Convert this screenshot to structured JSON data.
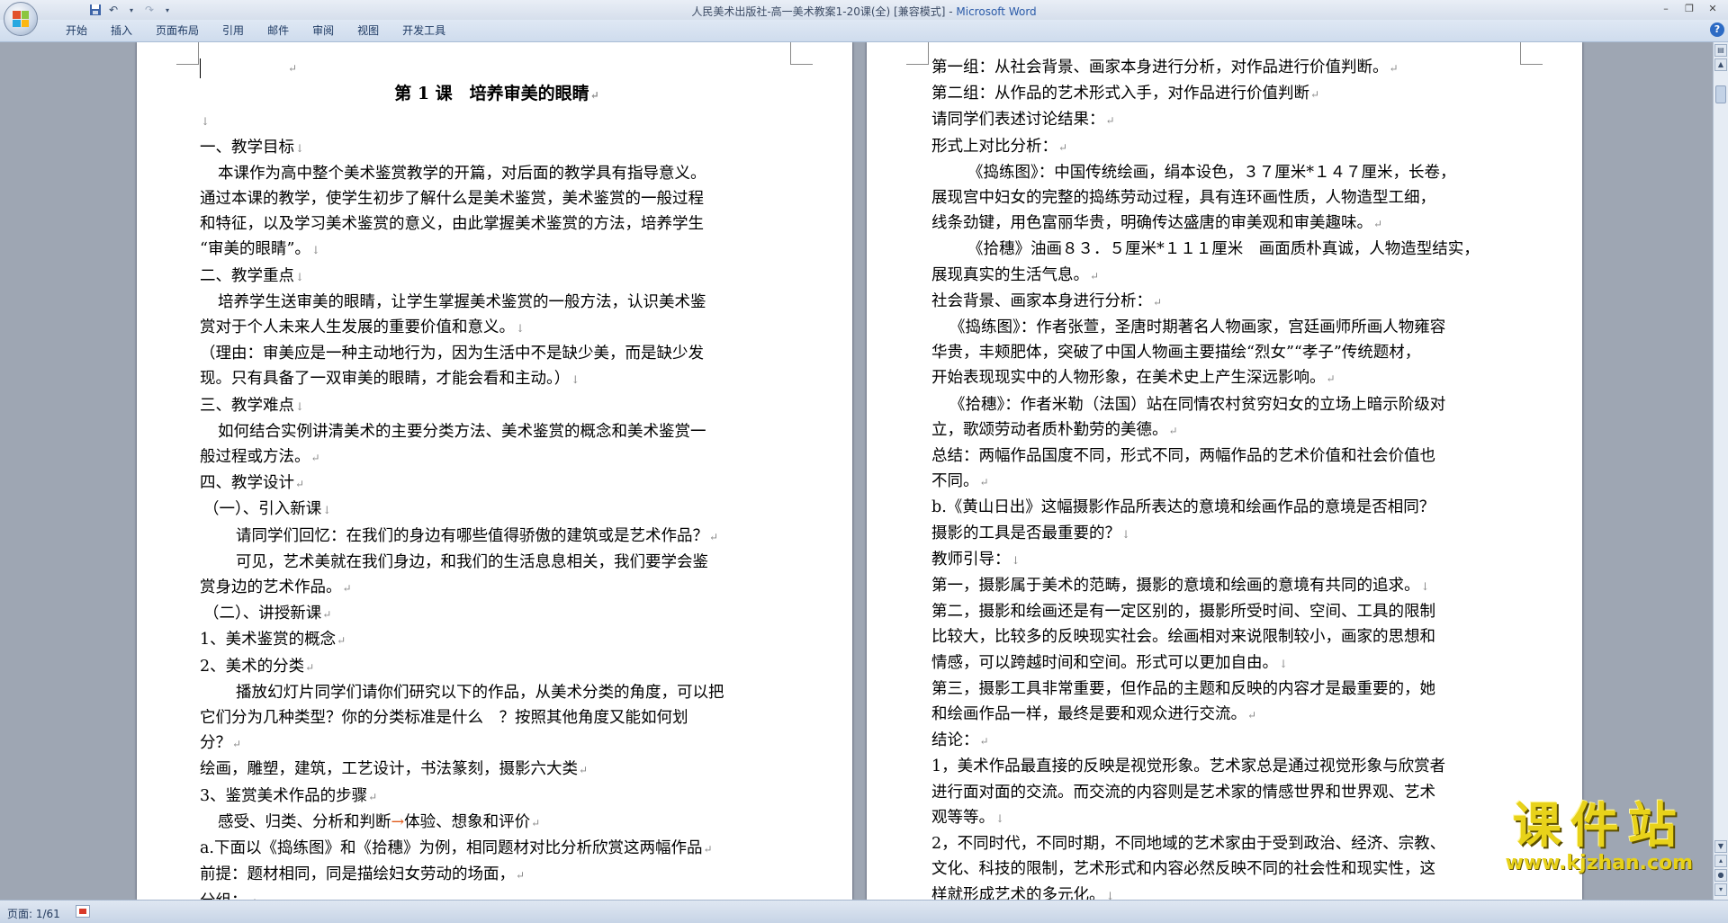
{
  "window": {
    "title": "人民美术出版社-高一美术教案1-20课(全) [兼容模式] - ",
    "app": "Microsoft Word"
  },
  "ribbon": {
    "tabs": [
      "开始",
      "插入",
      "页面布局",
      "引用",
      "邮件",
      "审阅",
      "视图",
      "开发工具"
    ]
  },
  "status": {
    "page_count": "页面: 1/61"
  },
  "watermark": {
    "text": "课件站",
    "url": "www.kjzhan.com"
  },
  "icons": {
    "save": "save-icon",
    "undo": "undo-icon",
    "redo": "redo-icon",
    "help": "help-icon"
  },
  "document": {
    "page_title": "第 1 课　培养审美的眼睛",
    "left_lines": [
      "一、教学目标",
      "本课作为高中整个美术鉴赏教学的开篇，对后面的教学具有指导意义。",
      "通过本课的教学，使学生初步了解什么是美术鉴赏，美术鉴赏的一般过程",
      "和特征，以及学习美术鉴赏的意义，由此掌握美术鉴赏的方法，培养学生",
      "“审美的眼睛”。",
      "二、教学重点",
      "培养学生送审美的眼睛，让学生掌握美术鉴赏的一般方法，认识美术鉴",
      "赏对于个人未来人生发展的重要价值和意义。",
      "（理由：审美应是一种主动地行为，因为生活中不是缺少美，而是缺少发",
      "现。只有具备了一双审美的眼睛，才能会看和主动。）",
      "三、教学难点",
      "如何结合实例讲清美术的主要分类方法、美术鉴赏的概念和美术鉴赏一",
      "般过程或方法。",
      "四、教学设计",
      "（一）、引入新课",
      "请同学们回忆：在我们的身边有哪些值得骄傲的建筑或是艺术作品？",
      "可见，艺术美就在我们身边，和我们的生活息息相关，我们要学会鉴",
      "赏身边的艺术作品。",
      "（二）、讲授新课",
      "1、美术鉴赏的概念",
      "2、美术的分类",
      "播放幻灯片同学们请你们研究以下的作品，从美术分类的角度，可以把",
      "它们分为几种类型？你的分类标准是什么　？按照其他角度又能如何划",
      "分？",
      "绘画，雕塑，建筑，工艺设计，书法篆刻，摄影六大类",
      "3、鉴赏美术作品的步骤",
      "感受、归类、分析和判断",
      "体验、想象和评价",
      "a.下面以《捣练图》和《拾穗》为例，相同题材对比分析欣赏这两幅作品",
      "前提：题材相同，同是描绘妇女劳动的场面，",
      "分组："
    ],
    "arrow": "→",
    "right_lines": [
      "第一组：从社会背景、画家本身进行分析，对作品进行价值判断。",
      "第二组：从作品的艺术形式入手，对作品进行价值判断",
      "请同学们表述讨论结果：",
      "形式上对比分析：",
      "《捣练图》：中国传统绘画，绢本设色，３７厘米*１４７厘米，长卷，",
      "展现宫中妇女的完整的捣练劳动过程，具有连环画性质，人物造型工细，",
      "线条劲键，用色富丽华贵，明确传达盛唐的审美观和审美趣味。",
      "《拾穗》油画８３．５厘米*１１１厘米　画面质朴真诚，人物造型结实，",
      "展现真实的生活气息。",
      "社会背景、画家本身进行分析：",
      "《捣练图》：作者张萱，圣唐时期著名人物画家，宫廷画师所画人物雍容",
      "华贵，丰颊肥体，突破了中国人物画主要描绘“烈女”“孝子”传统题材，",
      "开始表现现实中的人物形象，在美术史上产生深远影响。",
      "《拾穗》：作者米勒（法国）站在同情农村贫穷妇女的立场上暗示阶级对",
      "立，歌颂劳动者质朴勤劳的美德。",
      "总结：两幅作品国度不同，形式不同，两幅作品的艺术价值和社会价值也",
      "不同。",
      "b.《黄山日出》这幅摄影作品所表达的意境和绘画作品的意境是否相同？",
      "摄影的工具是否最重要的？",
      "教师引导：",
      "第一，摄影属于美术的范畴，摄影的意境和绘画的意境有共同的追求。",
      "第二，摄影和绘画还是有一定区别的，摄影所受时间、空间、工具的限制",
      "比较大，比较多的反映现实社会。绘画相对来说限制较小，画家的思想和",
      "情感，可以跨越时间和空间。形式可以更加自由。",
      "第三，摄影工具非常重要，但作品的主题和反映的内容才是最重要的，她",
      "和绘画作品一样，最终是要和观众进行交流。",
      "结论：",
      "1，美术作品最直接的反映是视觉形象。艺术家总是通过视觉形象与欣赏者",
      "进行面对面的交流。而交流的内容则是艺术家的情感世界和世界观、艺术",
      "观等等。",
      "2，不同时代，不同时期，不同地域的艺术家由于受到政治、经济、宗教、",
      "文化、科技的限制，艺术形式和内容必然反映不同的社会性和现实性，这",
      "样就形成艺术的多元化。"
    ]
  }
}
